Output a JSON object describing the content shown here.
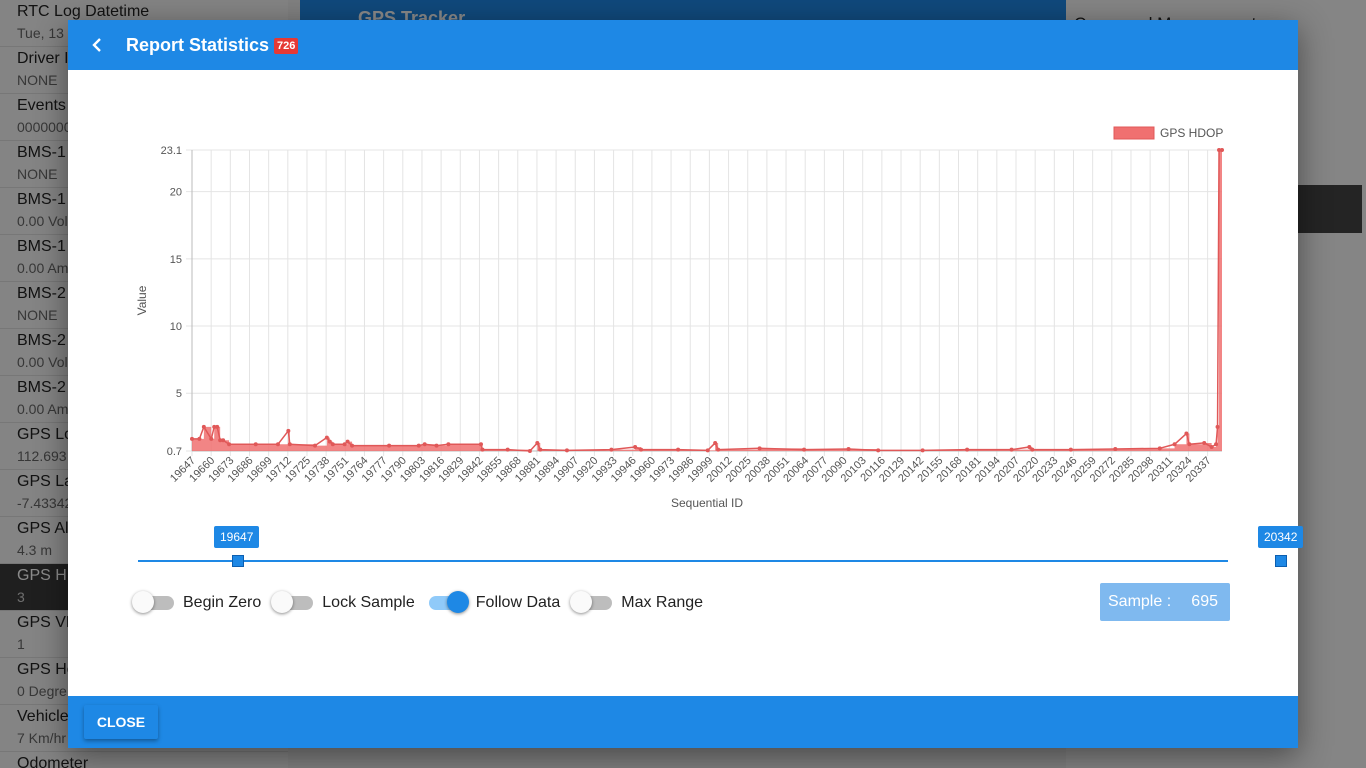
{
  "background": {
    "list_items": [
      {
        "title": "RTC Log Datetime",
        "value": "Tue, 13"
      },
      {
        "title": "Driver I",
        "value": "NONE"
      },
      {
        "title": "Events",
        "value": "0000000"
      },
      {
        "title": "BMS-1",
        "value": "NONE"
      },
      {
        "title": "BMS-1",
        "value": "0.00 Vol"
      },
      {
        "title": "BMS-1",
        "value": "0.00 Am"
      },
      {
        "title": "BMS-2",
        "value": "NONE"
      },
      {
        "title": "BMS-2",
        "value": "0.00 Vol"
      },
      {
        "title": "BMS-2",
        "value": "0.00 Am"
      },
      {
        "title": "GPS Lo",
        "value": "112.693"
      },
      {
        "title": "GPS La",
        "value": "-7.43342"
      },
      {
        "title": "GPS Alt",
        "value": "4.3 m"
      },
      {
        "title": "GPS HD",
        "value": "3"
      },
      {
        "title": "GPS VD",
        "value": "1"
      },
      {
        "title": "GPS He",
        "value": "0 Degre"
      },
      {
        "title": "Vehicle",
        "value": "7 Km/hr"
      },
      {
        "title": "Odometer",
        "value": ""
      }
    ],
    "header_title": "GPS Tracker",
    "right_title": "Command Management"
  },
  "dialog": {
    "title": "Report Statistics",
    "count_badge": "726",
    "close_label": "CLOSE"
  },
  "slider": {
    "min_label": "19647",
    "max_label": "20342"
  },
  "toggles": [
    {
      "label": "Begin Zero",
      "on": false
    },
    {
      "label": "Lock Sample",
      "on": false
    },
    {
      "label": "Follow Data",
      "on": true
    },
    {
      "label": "Max Range",
      "on": false
    }
  ],
  "sample": {
    "label": "Sample :",
    "value": "695"
  },
  "colors": {
    "primary": "#1e88e5",
    "series": "#f07070",
    "badge": "#e53935"
  },
  "chart_data": {
    "type": "area",
    "xlabel": "Sequential ID",
    "ylabel": "Value",
    "ylim": [
      0.7,
      23.1
    ],
    "yticks": [
      0.7,
      5,
      10,
      15,
      20,
      23.1
    ],
    "grid": true,
    "legend_position": "top-right",
    "series": [
      {
        "name": "GPS HDOP",
        "color": "#f07070"
      }
    ],
    "x_tick_labels": [
      "19647",
      "19660",
      "19673",
      "19686",
      "19699",
      "19712",
      "19725",
      "19738",
      "19751",
      "19764",
      "19777",
      "19790",
      "19803",
      "19816",
      "19829",
      "19842",
      "19855",
      "19868",
      "19881",
      "19894",
      "19907",
      "19920",
      "19933",
      "19946",
      "19960",
      "19973",
      "19986",
      "19999",
      "20012",
      "20025",
      "20038",
      "20051",
      "20064",
      "20077",
      "20090",
      "20103",
      "20116",
      "20129",
      "20142",
      "20155",
      "20168",
      "20181",
      "20194",
      "20207",
      "20220",
      "20233",
      "20246",
      "20259",
      "20272",
      "20285",
      "20298",
      "20311",
      "20324",
      "20337"
    ],
    "x_range": [
      19647,
      20342
    ],
    "points": [
      [
        19647,
        1.6
      ],
      [
        19652,
        1.6
      ],
      [
        19655,
        2.5
      ],
      [
        19660,
        1.6
      ],
      [
        19662,
        2.5
      ],
      [
        19664,
        2.5
      ],
      [
        19666,
        1.5
      ],
      [
        19668,
        1.5
      ],
      [
        19672,
        1.2
      ],
      [
        19690,
        1.2
      ],
      [
        19705,
        1.2
      ],
      [
        19712,
        2.2
      ],
      [
        19713,
        1.2
      ],
      [
        19730,
        1.1
      ],
      [
        19738,
        1.7
      ],
      [
        19740,
        1.4
      ],
      [
        19742,
        1.2
      ],
      [
        19750,
        1.2
      ],
      [
        19752,
        1.4
      ],
      [
        19755,
        1.1
      ],
      [
        19780,
        1.1
      ],
      [
        19800,
        1.1
      ],
      [
        19804,
        1.2
      ],
      [
        19812,
        1.1
      ],
      [
        19820,
        1.2
      ],
      [
        19842,
        1.2
      ],
      [
        19843,
        0.8
      ],
      [
        19860,
        0.8
      ],
      [
        19875,
        0.7
      ],
      [
        19880,
        1.3
      ],
      [
        19882,
        0.8
      ],
      [
        19900,
        0.75
      ],
      [
        19930,
        0.8
      ],
      [
        19946,
        1.0
      ],
      [
        19950,
        0.8
      ],
      [
        19975,
        0.8
      ],
      [
        19995,
        0.75
      ],
      [
        20000,
        1.3
      ],
      [
        20002,
        0.8
      ],
      [
        20030,
        0.9
      ],
      [
        20060,
        0.8
      ],
      [
        20090,
        0.85
      ],
      [
        20110,
        0.75
      ],
      [
        20140,
        0.75
      ],
      [
        20170,
        0.8
      ],
      [
        20200,
        0.8
      ],
      [
        20212,
        1.0
      ],
      [
        20214,
        0.8
      ],
      [
        20240,
        0.8
      ],
      [
        20270,
        0.85
      ],
      [
        20300,
        0.9
      ],
      [
        20310,
        1.2
      ],
      [
        20318,
        2.0
      ],
      [
        20320,
        1.2
      ],
      [
        20330,
        1.3
      ],
      [
        20335,
        1.0
      ],
      [
        20338,
        1.2
      ],
      [
        20339,
        2.5
      ],
      [
        20340,
        23.1
      ],
      [
        20342,
        23.1
      ]
    ]
  }
}
